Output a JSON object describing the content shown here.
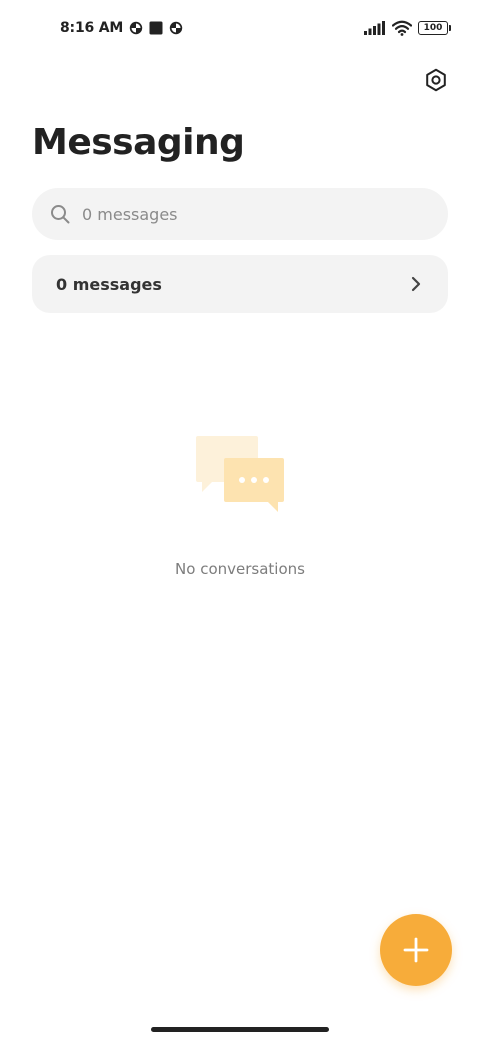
{
  "status_bar": {
    "time": "8:16 AM",
    "battery": "100",
    "icons": [
      "pie-indicator-icon",
      "stop-square-icon",
      "pie-indicator-icon",
      "signal-icon",
      "wifi-icon",
      "battery-icon"
    ]
  },
  "header": {
    "title": "Messaging",
    "settings_icon": "gear-icon"
  },
  "search": {
    "placeholder": "0 messages",
    "icon": "search-icon"
  },
  "messages_card": {
    "label": "0 messages",
    "icon": "chevron-right-icon"
  },
  "empty_state": {
    "text": "No conversations",
    "icon": "chat-bubbles-icon"
  },
  "fab": {
    "icon": "plus-icon"
  },
  "colors": {
    "accent": "#f7ac3a",
    "card_bg": "#f3f3f3",
    "illustration_light": "#fdf1da",
    "illustration_main": "#fde3b0"
  }
}
